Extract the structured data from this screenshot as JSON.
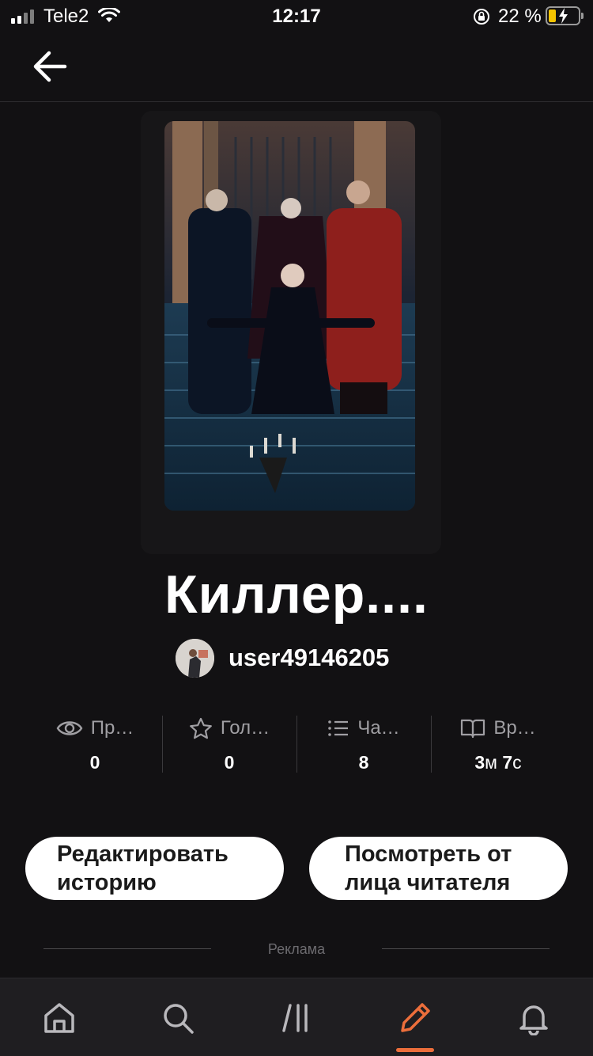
{
  "status_bar": {
    "carrier": "Tele2",
    "time": "12:17",
    "battery_percent": "22 %"
  },
  "story": {
    "title": "Киллер....",
    "author": "user49146205"
  },
  "stats": [
    {
      "icon": "eye-icon",
      "label": "Пр…",
      "value": "0"
    },
    {
      "icon": "star-icon",
      "label": "Гол…",
      "value": "0"
    },
    {
      "icon": "list-icon",
      "label": "Ча…",
      "value": "8"
    },
    {
      "icon": "book-icon",
      "label": "Вр…",
      "value_number_1": "3",
      "value_unit_1": "м",
      "value_number_2": "7",
      "value_unit_2": "с"
    }
  ],
  "actions": {
    "edit_line1": "Редактировать",
    "edit_line2": "историю",
    "preview_line1": "Посмотреть от",
    "preview_line2": "лица читателя"
  },
  "ad_label": "Реклама",
  "tab_bar": {
    "items": [
      "home-icon",
      "search-icon",
      "library-icon",
      "write-icon",
      "notifications-icon"
    ],
    "active": "write-icon",
    "accent_color": "#ec6e3b"
  }
}
